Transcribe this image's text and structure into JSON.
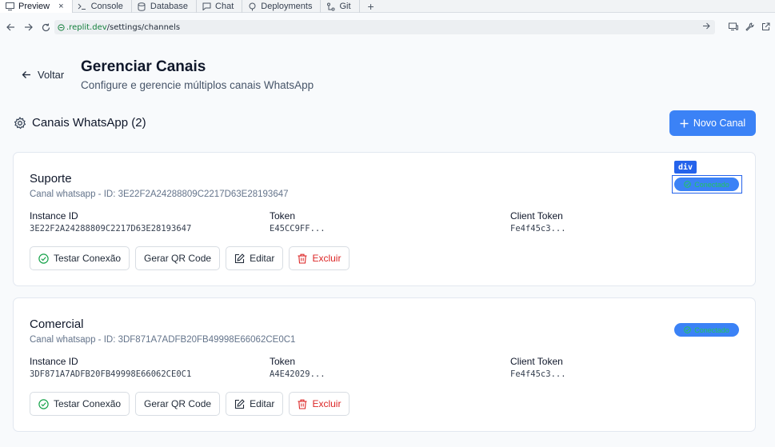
{
  "browser": {
    "tabs": [
      {
        "label": "Preview",
        "icon": "monitor-icon",
        "active": true,
        "closable": true
      },
      {
        "label": "Console",
        "icon": "terminal-icon"
      },
      {
        "label": "Database",
        "icon": "database-icon"
      },
      {
        "label": "Chat",
        "icon": "chat-icon"
      },
      {
        "label": "Deployments",
        "icon": "deploy-icon"
      },
      {
        "label": "Git",
        "icon": "git-icon"
      }
    ],
    "close_glyph": "×",
    "add_glyph": "+",
    "url_host": ".replit.dev",
    "url_path": "/settings/channels"
  },
  "header": {
    "back_label": "Voltar",
    "title": "Gerenciar Canais",
    "subtitle": "Configure e gerencie múltiplos canais WhatsApp"
  },
  "section": {
    "title": "Canais WhatsApp (2)",
    "new_button": "Novo Canal"
  },
  "labels": {
    "instance_id": "Instance ID",
    "token": "Token",
    "client_token": "Client Token"
  },
  "actions": {
    "test": "Testar Conexão",
    "qr": "Gerar QR Code",
    "edit": "Editar",
    "delete": "Excluir"
  },
  "channels": [
    {
      "name": "Suporte",
      "meta": "Canal whatsapp - ID: 3E22F2A24288809C2217D63E28193647",
      "instance_id": "3E22F2A24288809C2217D63E28193647",
      "token": "E45CC9FF...",
      "client_token": "Fe4f45c3...",
      "status": "Conectado"
    },
    {
      "name": "Comercial",
      "meta": "Canal whatsapp - ID: 3DF871A7ADFB20FB49998E66062CE0C1",
      "instance_id": "3DF871A7ADFB20FB49998E66062CE0C1",
      "token": "A4E42029...",
      "client_token": "Fe4f45c3...",
      "status": "Conectado"
    }
  ],
  "inspector": {
    "tag": "div"
  },
  "colors": {
    "primary": "#3b82f6",
    "success": "#22c55e",
    "danger": "#dc2626"
  }
}
